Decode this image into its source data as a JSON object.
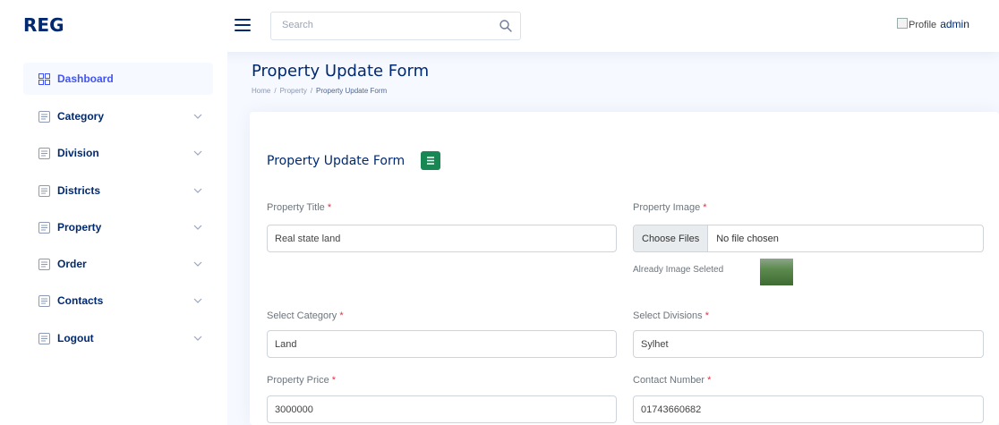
{
  "header": {
    "logo": "REG",
    "search": {
      "placeholder": "Search"
    },
    "profile": {
      "image_alt": "Profile",
      "username": "admin"
    }
  },
  "sidebar": {
    "items": [
      {
        "label": "Dashboard",
        "icon": "grid-icon",
        "active": true
      },
      {
        "label": "Category",
        "icon": "menu-button-icon"
      },
      {
        "label": "Division",
        "icon": "menu-button-icon"
      },
      {
        "label": "Districts",
        "icon": "menu-button-icon"
      },
      {
        "label": "Property",
        "icon": "menu-button-icon"
      },
      {
        "label": "Order",
        "icon": "menu-button-icon"
      },
      {
        "label": "Contacts",
        "icon": "menu-button-icon"
      },
      {
        "label": "Logout",
        "icon": "menu-button-icon"
      }
    ]
  },
  "page": {
    "title": "Property Update Form",
    "breadcrumb": [
      "Home",
      "Property",
      "Property Update Form"
    ]
  },
  "form": {
    "title": "Property Update Form",
    "required_mark": "*",
    "fields": {
      "property_title": {
        "label": "Property Title",
        "value": "Real state land"
      },
      "property_image": {
        "label": "Property Image",
        "button": "Choose Files",
        "status": "No file chosen",
        "existing_note": "Already Image Seleted"
      },
      "category": {
        "label": "Select Category",
        "value": "Land"
      },
      "division": {
        "label": "Select Divisions",
        "value": "Sylhet"
      },
      "price": {
        "label": "Property Price",
        "value": "3000000"
      },
      "contact": {
        "label": "Contact Number",
        "value": "01743660682"
      }
    }
  },
  "colors": {
    "brand": "#012970",
    "accent": "#4154f1",
    "success": "#198754",
    "required": "#dc3545",
    "background": "#f6f9ff"
  }
}
